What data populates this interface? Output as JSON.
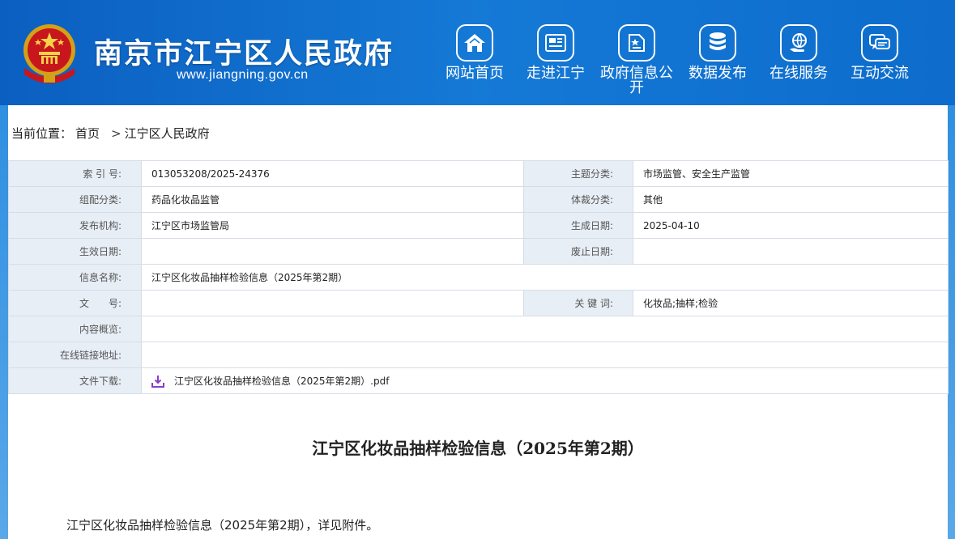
{
  "header": {
    "site_title": "南京市江宁区人民政府",
    "site_url": "www.jiangning.gov.cn",
    "nav": [
      {
        "label": "网站首页",
        "icon": "home-icon"
      },
      {
        "label": "走进江宁",
        "icon": "newspaper-icon"
      },
      {
        "label": "政府信息公开",
        "icon": "document-star-icon"
      },
      {
        "label": "数据发布",
        "icon": "database-icon"
      },
      {
        "label": "在线服务",
        "icon": "globe-hand-icon"
      },
      {
        "label": "互动交流",
        "icon": "chat-icon"
      }
    ]
  },
  "breadcrumb": {
    "prefix": "当前位置：",
    "home": "首页",
    "separator": ">",
    "current": "江宁区人民政府"
  },
  "meta": {
    "index_no_label": "索 引 号:",
    "index_no": "013053208/2025-24376",
    "topic_label": "主题分类:",
    "topic": "市场监管、安全生产监管",
    "org_cat_label": "组配分类:",
    "org_cat": "药品化妆品监管",
    "genre_label": "体裁分类:",
    "genre": "其他",
    "publisher_label": "发布机构:",
    "publisher": "江宁区市场监管局",
    "gen_date_label": "生成日期:",
    "gen_date": "2025-04-10",
    "eff_date_label": "生效日期:",
    "eff_date": "",
    "abolish_label": "废止日期:",
    "abolish": "",
    "name_label": "信息名称:",
    "name": "江宁区化妆品抽样检验信息（2025年第2期）",
    "doc_no_label": "文　　号:",
    "doc_no": "",
    "keywords_label": "关 键 词:",
    "keywords": "化妆品;抽样;检验",
    "overview_label": "内容概览:",
    "overview": "",
    "link_label": "在线链接地址:",
    "link": "",
    "download_label": "文件下载:",
    "download": "江宁区化妆品抽样检验信息（2025年第2期）.pdf"
  },
  "document": {
    "title": "江宁区化妆品抽样检验信息（2025年第2期）",
    "body": "江宁区化妆品抽样检验信息（2025年第2期），详见附件。"
  },
  "colors": {
    "header_blue": "#0b5fc0",
    "label_bg": "#e8eef6",
    "border": "#d6dde6",
    "download_icon": "#8a3ec8"
  }
}
